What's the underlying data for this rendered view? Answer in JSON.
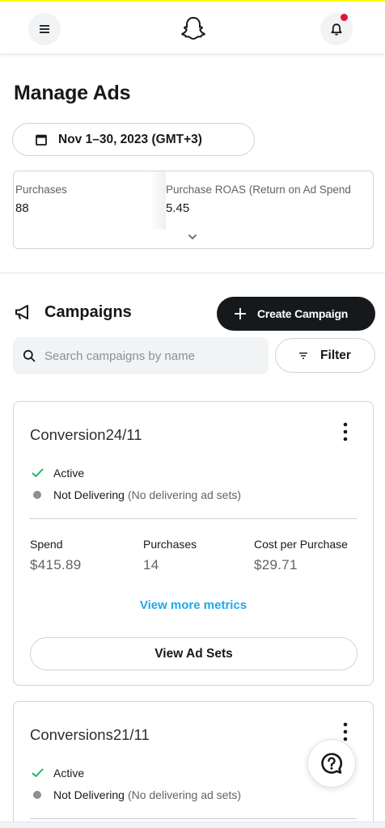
{
  "header": {
    "menu_icon": "hamburger-menu-icon",
    "logo_icon": "snapchat-ghost-icon",
    "notifications_icon": "bell-icon",
    "notification_dot_color": "#e1143d"
  },
  "page_title": "Manage Ads",
  "date_range": {
    "label": "Nov 1–30, 2023 (GMT+3)",
    "icon": "calendar-icon"
  },
  "metrics": [
    {
      "label": "Purchases",
      "value": "88"
    },
    {
      "label": "Purchase ROAS (Return on Ad Spend",
      "value": "5.45"
    }
  ],
  "campaigns_section": {
    "title": "Campaigns",
    "icon": "megaphone-icon",
    "create_label": "Create Campaign",
    "search_placeholder": "Search campaigns by name",
    "filter_label": "Filter"
  },
  "campaigns": [
    {
      "name": "Conversion24/11",
      "status_active": "Active",
      "delivery_status": "Not Delivering",
      "delivery_note": "(No delivering ad sets)",
      "stats": [
        {
          "label": "Spend",
          "value": "$415.89"
        },
        {
          "label": "Purchases",
          "value": "14"
        },
        {
          "label": "Cost per Purchase",
          "value": "$29.71"
        }
      ],
      "more_metrics_label": "View more metrics",
      "view_ad_sets_label": "View Ad Sets"
    },
    {
      "name": "Conversions21/11",
      "status_active": "Active",
      "delivery_status": "Not Delivering",
      "delivery_note": "(No delivering ad sets)"
    }
  ],
  "help_icon": "help-chat-icon",
  "colors": {
    "accent_link": "#1da9ec",
    "active_check": "#20b36b",
    "primary_button": "#16191c",
    "brand_yellow": "#fffc00"
  }
}
